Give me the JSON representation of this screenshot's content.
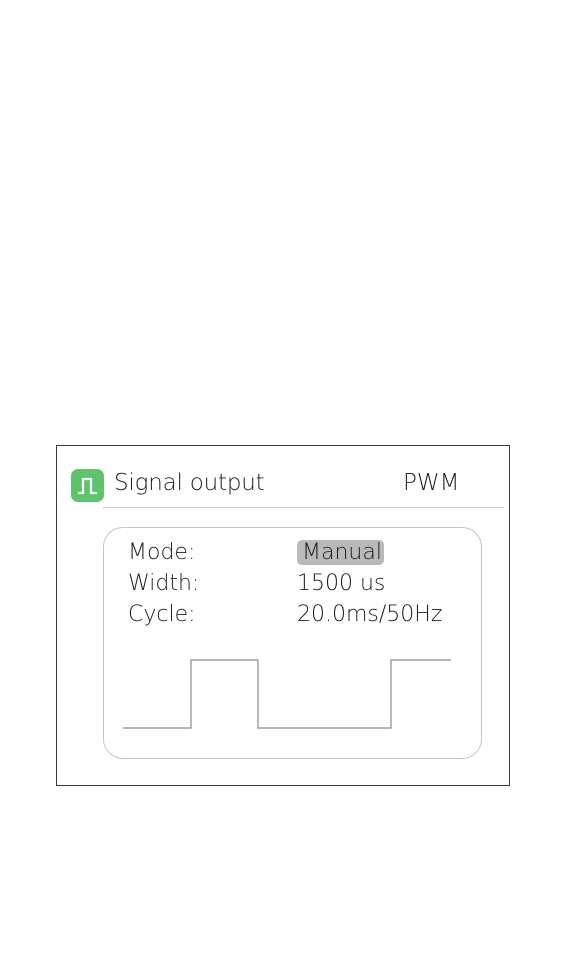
{
  "header": {
    "title": "Signal output",
    "signal_type": "PWM",
    "icon": "square-wave-icon",
    "icon_color": "#5ec46b"
  },
  "settings": {
    "mode": {
      "label": "Mode:",
      "value": "Manual"
    },
    "width": {
      "label": "Width:",
      "value": "1500 us"
    },
    "cycle": {
      "label": "Cycle:",
      "value": "20.0ms/50Hz"
    }
  },
  "waveform": {
    "type": "pwm-square-wave",
    "stroke_color": "#8a8a8a"
  }
}
